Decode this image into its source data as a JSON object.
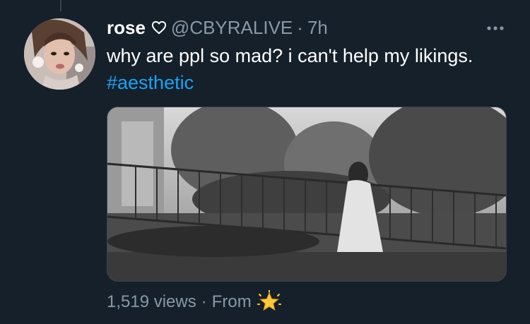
{
  "tweet": {
    "display_name": "rose",
    "handle": "@CBYRALIVE",
    "separator": "·",
    "time": "7h",
    "more_icon": "more-horizontal-icon",
    "text_main": "why are ppl so mad? i can't help my likings.",
    "hashtag": "#aesthetic",
    "media": {
      "type": "video",
      "description_icon": "video-thumbnail"
    },
    "footer": {
      "views": "1,519 views",
      "separator": "·",
      "from_label": "From",
      "source_icon": "sparkle-star-icon"
    }
  },
  "colors": {
    "background": "#15202b",
    "text": "#ffffff",
    "muted": "#8899a6",
    "link": "#1da1f2",
    "border": "#38444d"
  }
}
